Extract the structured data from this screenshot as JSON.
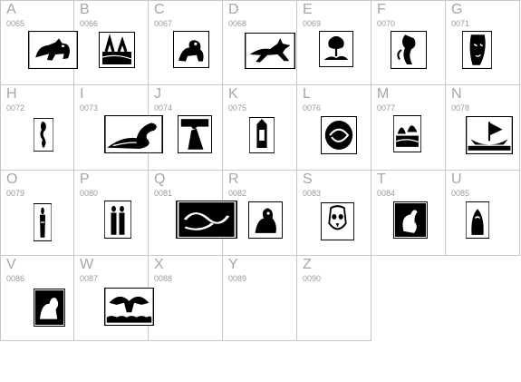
{
  "glyphs": [
    {
      "letter": "A",
      "code": "0065",
      "icon": "black-cat-illustration-icon",
      "has_glyph": true
    },
    {
      "letter": "B",
      "code": "0066",
      "icon": "figures-landscape-illustration-icon",
      "has_glyph": true
    },
    {
      "letter": "C",
      "code": "0067",
      "icon": "lion-illustration-icon",
      "has_glyph": true
    },
    {
      "letter": "D",
      "code": "0068",
      "icon": "leaping-fox-illustration-icon",
      "has_glyph": true
    },
    {
      "letter": "E",
      "code": "0069",
      "icon": "tree-deer-illustration-icon",
      "has_glyph": true
    },
    {
      "letter": "F",
      "code": "0070",
      "icon": "mermaid-illustration-icon",
      "has_glyph": true
    },
    {
      "letter": "G",
      "code": "0071",
      "icon": "face-portrait-illustration-icon",
      "has_glyph": true
    },
    {
      "letter": "H",
      "code": "0072",
      "icon": "seahorse-illustration-icon",
      "has_glyph": true
    },
    {
      "letter": "I",
      "code": "0073",
      "icon": "phoenix-bird-illustration-icon",
      "has_glyph": true
    },
    {
      "letter": "J",
      "code": "0074",
      "icon": "knight-scene-illustration-icon",
      "has_glyph": true
    },
    {
      "letter": "K",
      "code": "0075",
      "icon": "tower-illustration-icon",
      "has_glyph": true
    },
    {
      "letter": "L",
      "code": "0076",
      "icon": "serpent-coil-illustration-icon",
      "has_glyph": true
    },
    {
      "letter": "M",
      "code": "0077",
      "icon": "trees-river-illustration-icon",
      "has_glyph": true
    },
    {
      "letter": "N",
      "code": "0078",
      "icon": "viking-ship-illustration-icon",
      "has_glyph": true
    },
    {
      "letter": "O",
      "code": "0079",
      "icon": "standing-figure-illustration-icon",
      "has_glyph": true
    },
    {
      "letter": "P",
      "code": "0080",
      "icon": "two-figures-illustration-icon",
      "has_glyph": true
    },
    {
      "letter": "Q",
      "code": "0081",
      "icon": "swirling-waves-illustration-icon",
      "has_glyph": true
    },
    {
      "letter": "R",
      "code": "0082",
      "icon": "rider-horse-illustration-icon",
      "has_glyph": true
    },
    {
      "letter": "S",
      "code": "0083",
      "icon": "owl-mask-illustration-icon",
      "has_glyph": true
    },
    {
      "letter": "T",
      "code": "0084",
      "icon": "swan-illustration-icon",
      "has_glyph": true
    },
    {
      "letter": "U",
      "code": "0085",
      "icon": "hooded-figure-illustration-icon",
      "has_glyph": true
    },
    {
      "letter": "V",
      "code": "0086",
      "icon": "griffin-illustration-icon",
      "has_glyph": true
    },
    {
      "letter": "W",
      "code": "0087",
      "icon": "eagle-waves-illustration-icon",
      "has_glyph": true
    },
    {
      "letter": "X",
      "code": "0088",
      "icon": "",
      "has_glyph": false
    },
    {
      "letter": "Y",
      "code": "0089",
      "icon": "",
      "has_glyph": false
    },
    {
      "letter": "Z",
      "code": "0090",
      "icon": "",
      "has_glyph": false
    }
  ],
  "colors": {
    "grid_line": "#c8c8c8",
    "label": "#a6a6a6",
    "code": "#9a9a9a",
    "ink": "#000000"
  }
}
